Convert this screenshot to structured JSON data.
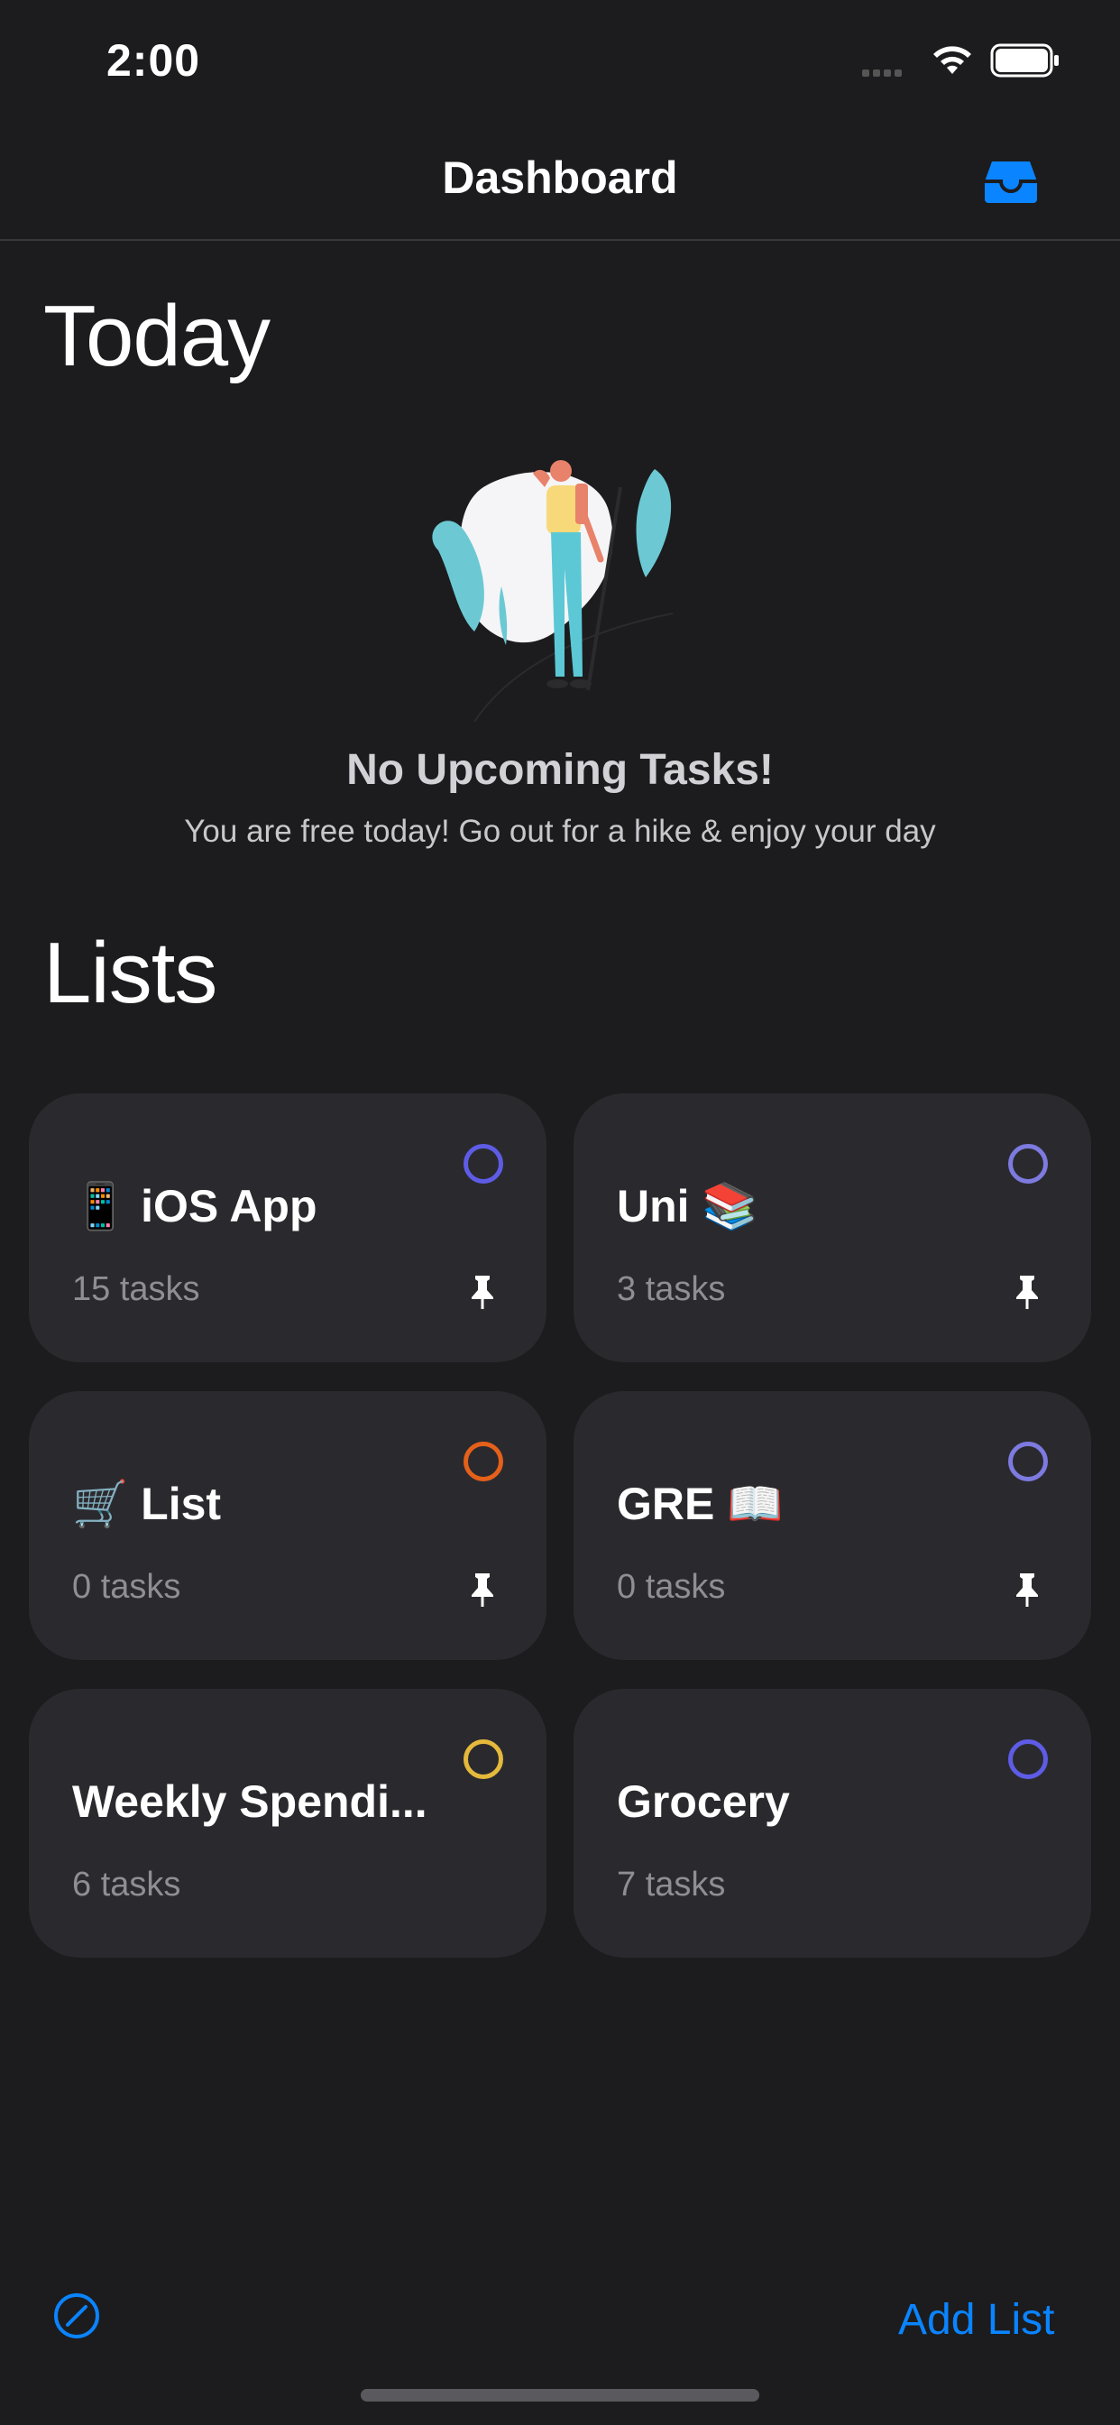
{
  "status": {
    "time": "2:00"
  },
  "nav": {
    "title": "Dashboard"
  },
  "today": {
    "title": "Today",
    "empty_title": "No Upcoming Tasks!",
    "empty_subtitle": "You are free today! Go out for a hike & enjoy your day"
  },
  "lists": {
    "title": "Lists",
    "items": [
      {
        "name": "📱 iOS App",
        "count": "15 tasks",
        "ring_color": "#5e5ce6",
        "pinned": true
      },
      {
        "name": "Uni 📚",
        "count": "3 tasks",
        "ring_color": "#7d7ae0",
        "pinned": true
      },
      {
        "name": "🛒 List",
        "count": "0 tasks",
        "ring_color": "#e5601a",
        "pinned": true
      },
      {
        "name": "GRE 📖",
        "count": "0 tasks",
        "ring_color": "#7d7ae0",
        "pinned": true
      },
      {
        "name": "Weekly Spendi...",
        "count": "6 tasks",
        "ring_color": "#e5b93c",
        "pinned": false
      },
      {
        "name": "Grocery",
        "count": "7 tasks",
        "ring_color": "#5e5ce6",
        "pinned": false
      }
    ]
  },
  "footer": {
    "add_list_label": "Add List"
  },
  "colors": {
    "accent": "#0a84ff",
    "background": "#1c1c1e",
    "card": "#2a2a2e"
  }
}
